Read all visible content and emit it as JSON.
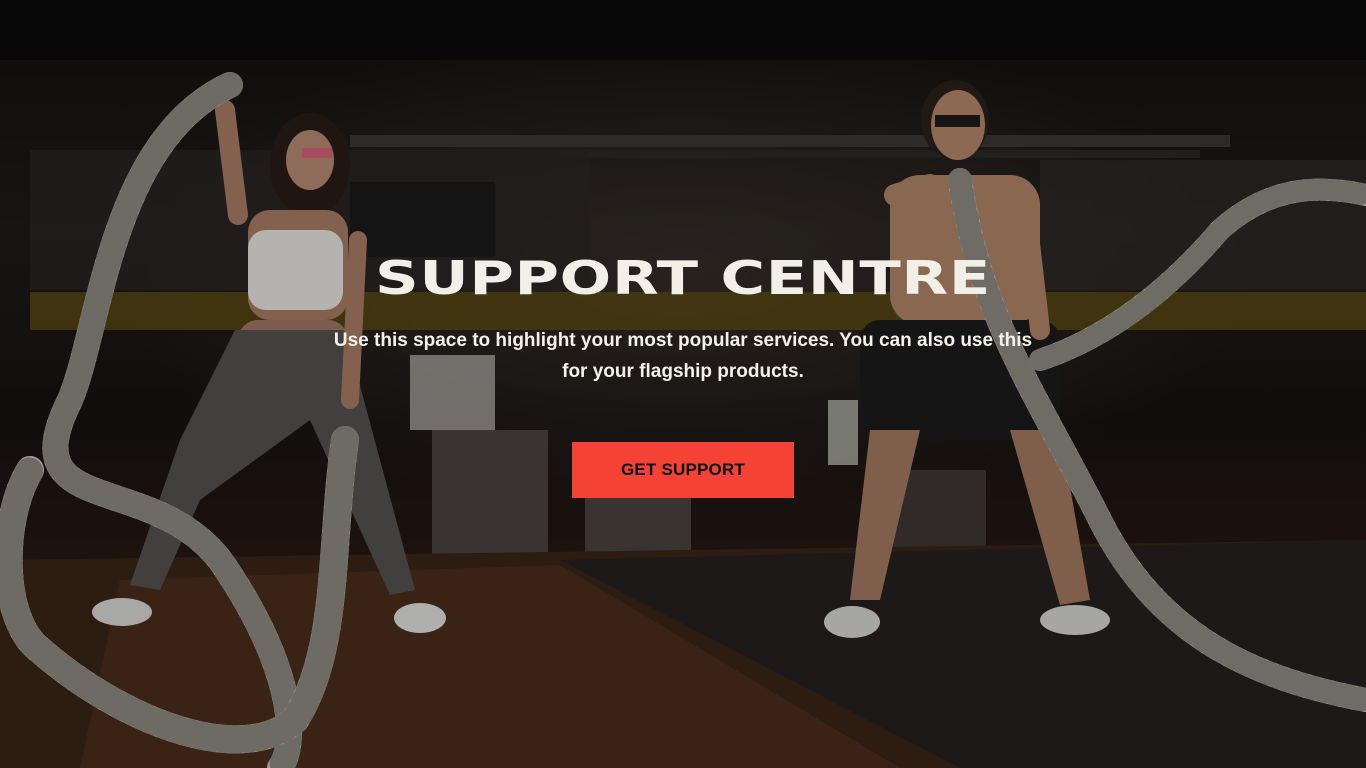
{
  "hero": {
    "title": "SUPPORT CENTRE",
    "subtitle": "Use this space to highlight your most popular services. You can also use this for your flagship products.",
    "cta_label": "GET SUPPORT",
    "background_image": "gym-battle-ropes-photo",
    "colors": {
      "cta_background": "#f44336",
      "cta_text": "#111111",
      "title_text": "#f2eee8"
    }
  }
}
